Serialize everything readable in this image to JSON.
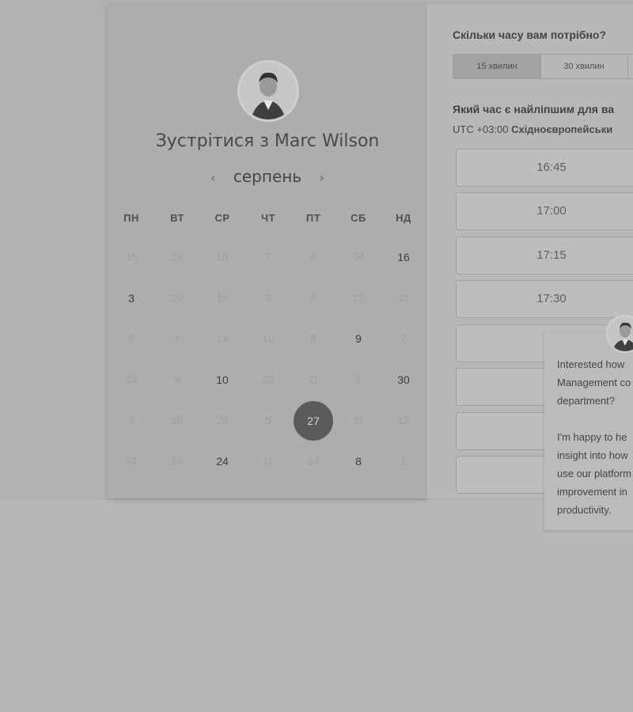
{
  "scheduler": {
    "title": "Зустрітися з Marc Wilson",
    "month": "серпень",
    "nav_prev": "‹",
    "nav_next": "›",
    "weekdays": [
      "ПН",
      "ВТ",
      "СР",
      "ЧТ",
      "ПТ",
      "СБ",
      "НД"
    ],
    "weeks": [
      [
        "15",
        "23",
        "10",
        "7",
        "8",
        "24",
        "16"
      ],
      [
        "3",
        "20",
        "10",
        "3",
        "5",
        "12",
        "31"
      ],
      [
        "5",
        "1",
        "14",
        "10",
        "5",
        "9",
        "7"
      ],
      [
        "22",
        "9",
        "10",
        "23",
        "21",
        "1",
        "30"
      ],
      [
        "3",
        "26",
        "28",
        "5",
        "27",
        "31",
        "12"
      ],
      [
        "24",
        "14",
        "24",
        "11",
        "24",
        "8",
        "1"
      ]
    ],
    "active_days": [
      [
        0,
        6
      ],
      [
        1,
        0
      ],
      [
        2,
        5
      ],
      [
        3,
        2
      ],
      [
        3,
        6
      ],
      [
        4,
        4
      ],
      [
        5,
        2
      ],
      [
        5,
        5
      ]
    ],
    "selected_day": [
      4,
      4
    ]
  },
  "booking": {
    "duration_question": "Скільки часу вам потрібно?",
    "durations": [
      "15 хвилин",
      "30 хвилин"
    ],
    "selected_duration_index": 0,
    "time_question": "Який час є найліпшим для ва",
    "timezone_offset": "UTC +03:00",
    "timezone_name": "Східноєвропейськи",
    "slots": [
      "16:45",
      "17:00",
      "17:15",
      "17:30",
      "",
      "",
      "",
      ""
    ]
  },
  "chat": {
    "lines": [
      "Interested how",
      "Management co",
      "department?",
      "",
      "I'm happy to he",
      "insight into how",
      "use our platform",
      "improvement in",
      "productivity."
    ]
  },
  "colors": {
    "overlay": "#b1b1b1",
    "selected_day": "#5b5b5b"
  }
}
